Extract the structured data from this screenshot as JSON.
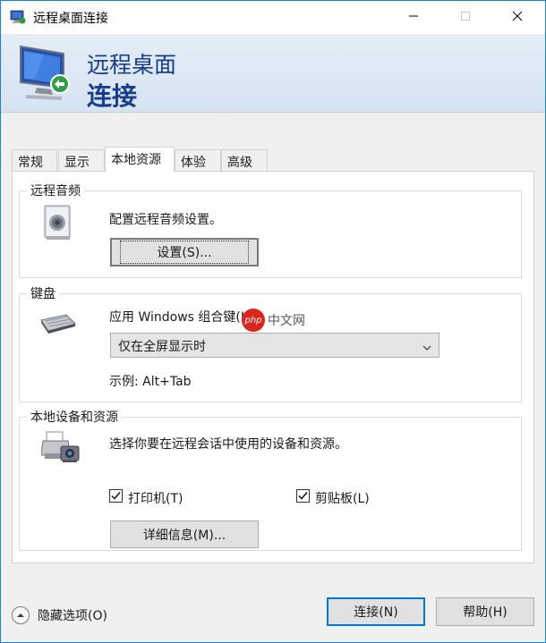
{
  "window": {
    "title": "远程桌面连接",
    "accent": "#1883d7"
  },
  "banner": {
    "line1": "远程桌面",
    "line2": "连接"
  },
  "tabs": [
    {
      "label": "常规",
      "active": false
    },
    {
      "label": "显示",
      "active": false
    },
    {
      "label": "本地资源",
      "active": true
    },
    {
      "label": "体验",
      "active": false
    },
    {
      "label": "高级",
      "active": false
    }
  ],
  "remote_audio": {
    "legend": "远程音频",
    "description": "配置远程音频设置。",
    "settings_button": "设置(S)...",
    "icon": "speaker-icon"
  },
  "keyboard": {
    "legend": "键盘",
    "apply_label": "应用 Windows 组合键(K):",
    "selected_option": "仅在全屏显示时",
    "example": "示例: Alt+Tab",
    "icon": "keyboard-icon"
  },
  "local_devices": {
    "legend": "本地设备和资源",
    "description": "选择你要在远程会话中使用的设备和资源。",
    "printers": {
      "label": "打印机(T)",
      "checked": true
    },
    "clipboard": {
      "label": "剪贴板(L)",
      "checked": true
    },
    "details_button": "详细信息(M)...",
    "icon": "printer-camera-icon"
  },
  "watermark": {
    "badge": "php",
    "text": "中文网"
  },
  "footer": {
    "hide_options": "隐藏选项(O)",
    "connect_button": "连接(N)",
    "help_button": "帮助(H)"
  }
}
